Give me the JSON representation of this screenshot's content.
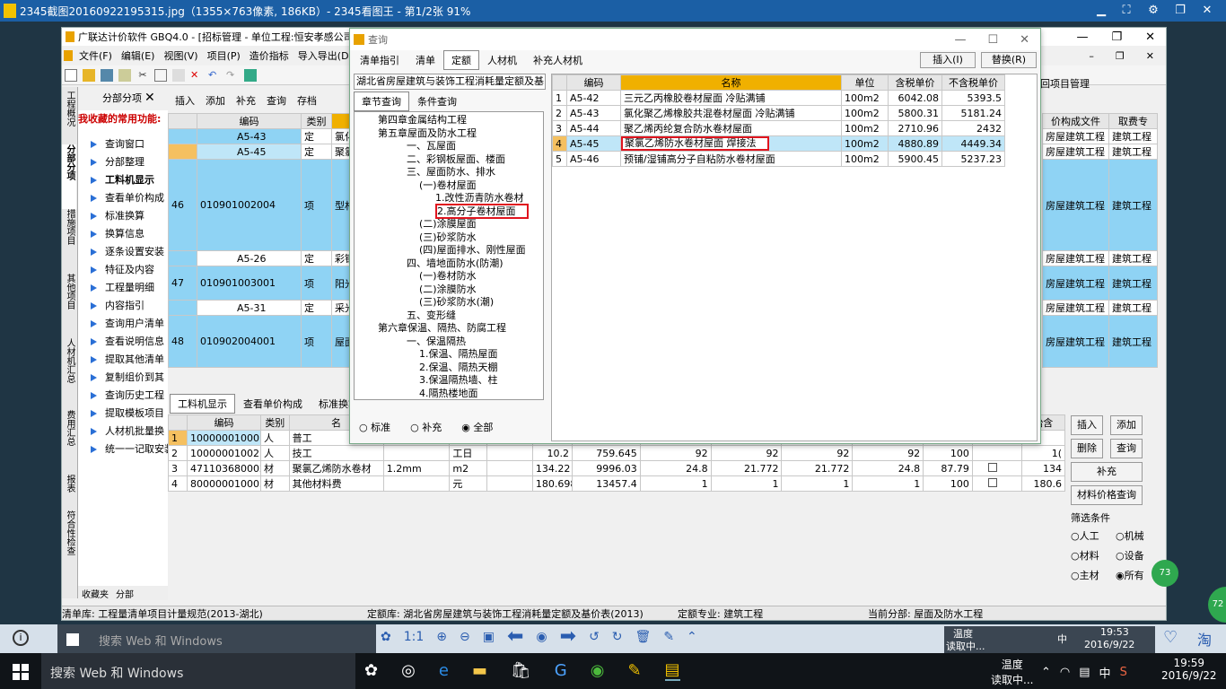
{
  "viewer": {
    "title": "2345截图20160922195315.jpg（1355×763像素, 186KB）- 2345看图王 - 第1/2张 91%"
  },
  "app": {
    "title": "广联达计价软件 GBQ4.0 - [招标管理 - 单位工程:恒安孝感公司2",
    "menu": [
      "文件(F)",
      "编辑(E)",
      "视图(V)",
      "项目(P)",
      "造价指标",
      "导入导出(D)",
      "系"
    ],
    "left_tabs": [
      "分部分项"
    ],
    "close_glyph": "✕",
    "subtoolbar": [
      "插入",
      "添加",
      "补充",
      "查询",
      "存档"
    ],
    "fav_title": "我收藏的常用功能:",
    "nav_items": [
      "查询窗口",
      "分部整理",
      "工料机显示",
      "查看单价构成",
      "标准换算",
      "换算信息",
      "逐条设置安装",
      "特征及内容",
      "工程量明细",
      "内容指引",
      "查询用户清单",
      "查看说明信息",
      "提取其他清单",
      "复制组价到其",
      "查询历史工程",
      "提取模板项目",
      "人材机批量换",
      "统一一记取安装"
    ],
    "side_vtabs": [
      "工程概况",
      "分部分项",
      "措施项目",
      "其他项目",
      "人材机汇总",
      "费用汇总",
      "报表",
      "符合性检查"
    ],
    "bottom_left": [
      "收藏夹",
      "分部"
    ],
    "grid_headers": [
      "编码",
      "类别",
      "名"
    ],
    "grid_rows": [
      {
        "no": "",
        "code": "A5-43",
        "type": "定",
        "name": "氯化"
      },
      {
        "no": "",
        "code": "A5-45",
        "type": "定",
        "name": "聚氯"
      },
      {
        "no": "46",
        "code": "010901002004",
        "type": "项",
        "name": "型材"
      },
      {
        "no": "",
        "code": "A5-26",
        "type": "定",
        "name": "彩钢"
      },
      {
        "no": "47",
        "code": "010901003001",
        "type": "项",
        "name": "阳光"
      },
      {
        "no": "",
        "code": "A5-31",
        "type": "定",
        "name": "采光"
      },
      {
        "no": "48",
        "code": "010902004001",
        "type": "项",
        "name": "屋面"
      }
    ],
    "right_headers": [
      "价构成文件",
      "取费专"
    ],
    "right_rows": [
      [
        "房屋建筑工程",
        "建筑工程"
      ],
      [
        "房屋建筑工程",
        "建筑工程"
      ],
      [
        "房屋建筑工程",
        "建筑工程"
      ],
      [
        "房屋建筑工程",
        "建筑工程"
      ],
      [
        "房屋建筑工程",
        "建筑工程"
      ],
      [
        "房屋建筑工程",
        "建筑工程"
      ],
      [
        "房屋建筑工程",
        "建筑工程"
      ]
    ],
    "return_link": "回项目管理",
    "bottom_tabs": [
      "工料机显示",
      "查看单价构成",
      "标准换算"
    ],
    "lower_headers": [
      "编码",
      "类别",
      "名",
      "",
      "",
      "",
      "",
      "",
      "",
      "",
      "",
      "",
      "",
      "",
      "",
      "胎含"
    ],
    "lower_rows": [
      {
        "no": "1",
        "code": "100000010001",
        "type": "人",
        "name": "普工",
        "spec": "",
        "unit": "",
        "a": "",
        "b": "",
        "c": "",
        "d": "",
        "e": "",
        "f": "",
        "g": "",
        "h": ""
      },
      {
        "no": "2",
        "code": "100000010021",
        "type": "人",
        "name": "技工",
        "spec": "",
        "unit": "工日",
        "a": "10.2",
        "b": "759.645",
        "c": "92",
        "d": "92",
        "e": "92",
        "f": "92",
        "g": "100",
        "h": "1("
      },
      {
        "no": "3",
        "code": "471103680002",
        "type": "材",
        "name": "聚氯乙烯防水卷材",
        "spec": "1.2mm",
        "unit": "m2",
        "a": "134.22",
        "b": "9996.03",
        "c": "24.8",
        "d": "21.772",
        "e": "21.772",
        "f": "24.8",
        "g": "87.79",
        "h": "134"
      },
      {
        "no": "4",
        "code": "800000010005",
        "type": "材",
        "name": "其他材料费",
        "spec": "",
        "unit": "元",
        "a": "180.698",
        "b": "13457.4",
        "c": "1",
        "d": "1",
        "e": "1",
        "f": "1",
        "g": "100",
        "h": "180.6"
      }
    ],
    "right_buttons": [
      "插入",
      "添加",
      "删除",
      "查询",
      "补充",
      "材料价格查询"
    ],
    "filter_title": "筛选条件",
    "filters": [
      "人工",
      "机械",
      "材料",
      "设备",
      "主材",
      "所有"
    ],
    "status": [
      "清单库: 工程量清单项目计量规范(2013-湖北)",
      "定额库: 湖北省房屋建筑与装饰工程消耗量定额及基价表(2013)",
      "定额专业: 建筑工程",
      "当前分部: 屋面及防水工程"
    ]
  },
  "dialog": {
    "title": "查询",
    "tabs": [
      "清单指引",
      "清单",
      "定额",
      "人材机",
      "补充人材机"
    ],
    "active_tab": "定额",
    "insert": "插入(I)",
    "replace": "替换(R)",
    "dropdown": "湖北省房屋建筑与装饰工程消耗量定额及基",
    "subtabs": [
      "章节查询",
      "条件查询"
    ],
    "tree": [
      "第四章金属结构工程",
      "第五章屋面及防水工程",
      "一、瓦屋面",
      "二、彩钢板屋面、楼面",
      "三、屋面防水、排水",
      "(一)卷材屋面",
      "1.改性沥青防水卷材",
      "2.高分子卷材屋面",
      "(二)涂膜屋面",
      "(三)砂浆防水",
      "(四)屋面排水、刚性屋面",
      "四、墙地面防水(防潮)",
      "(一)卷材防水",
      "(二)涂膜防水",
      "(三)砂浆防水(潮)",
      "五、变形缝",
      "第六章保温、隔热、防腐工程",
      "一、保温隔热",
      "1.保温、隔热屋面",
      "2.保温、隔热天棚",
      "3.保温隔热墙、柱",
      "4.隔热楼地面"
    ],
    "radios": [
      "标准",
      "补充",
      "全部"
    ],
    "table_headers": [
      "",
      "编码",
      "名称",
      "单位",
      "含税单价",
      "不含税单价"
    ],
    "rows": [
      {
        "no": "1",
        "code": "A5-42",
        "name": "三元乙丙橡胶卷材屋面 冷贴满铺",
        "unit": "100m2",
        "tax": "6042.08",
        "notax": "5393.5"
      },
      {
        "no": "2",
        "code": "A5-43",
        "name": "氯化聚乙烯橡胶共混卷材屋面 冷贴满铺",
        "unit": "100m2",
        "tax": "5800.31",
        "notax": "5181.24"
      },
      {
        "no": "3",
        "code": "A5-44",
        "name": "聚乙烯丙纶复合防水卷材屋面",
        "unit": "100m2",
        "tax": "2710.96",
        "notax": "2432"
      },
      {
        "no": "4",
        "code": "A5-45",
        "name": "聚氯乙烯防水卷材屋面 焊接法",
        "unit": "100m2",
        "tax": "4880.89",
        "notax": "4449.34"
      },
      {
        "no": "5",
        "code": "A5-46",
        "name": "预铺/湿铺高分子自粘防水卷材屋面",
        "unit": "100m2",
        "tax": "5900.45",
        "notax": "5237.23"
      }
    ]
  },
  "inner_taskbar": {
    "search": "搜索 Web 和 Windows",
    "temp": "温度",
    "temp2": "读取中...",
    "time": "19:53",
    "date": "2016/9/22",
    "ime": "中"
  },
  "taskbar": {
    "search": "搜索 Web 和 Windows",
    "temp": "温度",
    "temp2": "读取中...",
    "time": "19:59",
    "date": "2016/9/22",
    "ime": "中"
  },
  "badges": [
    "72",
    "73"
  ]
}
